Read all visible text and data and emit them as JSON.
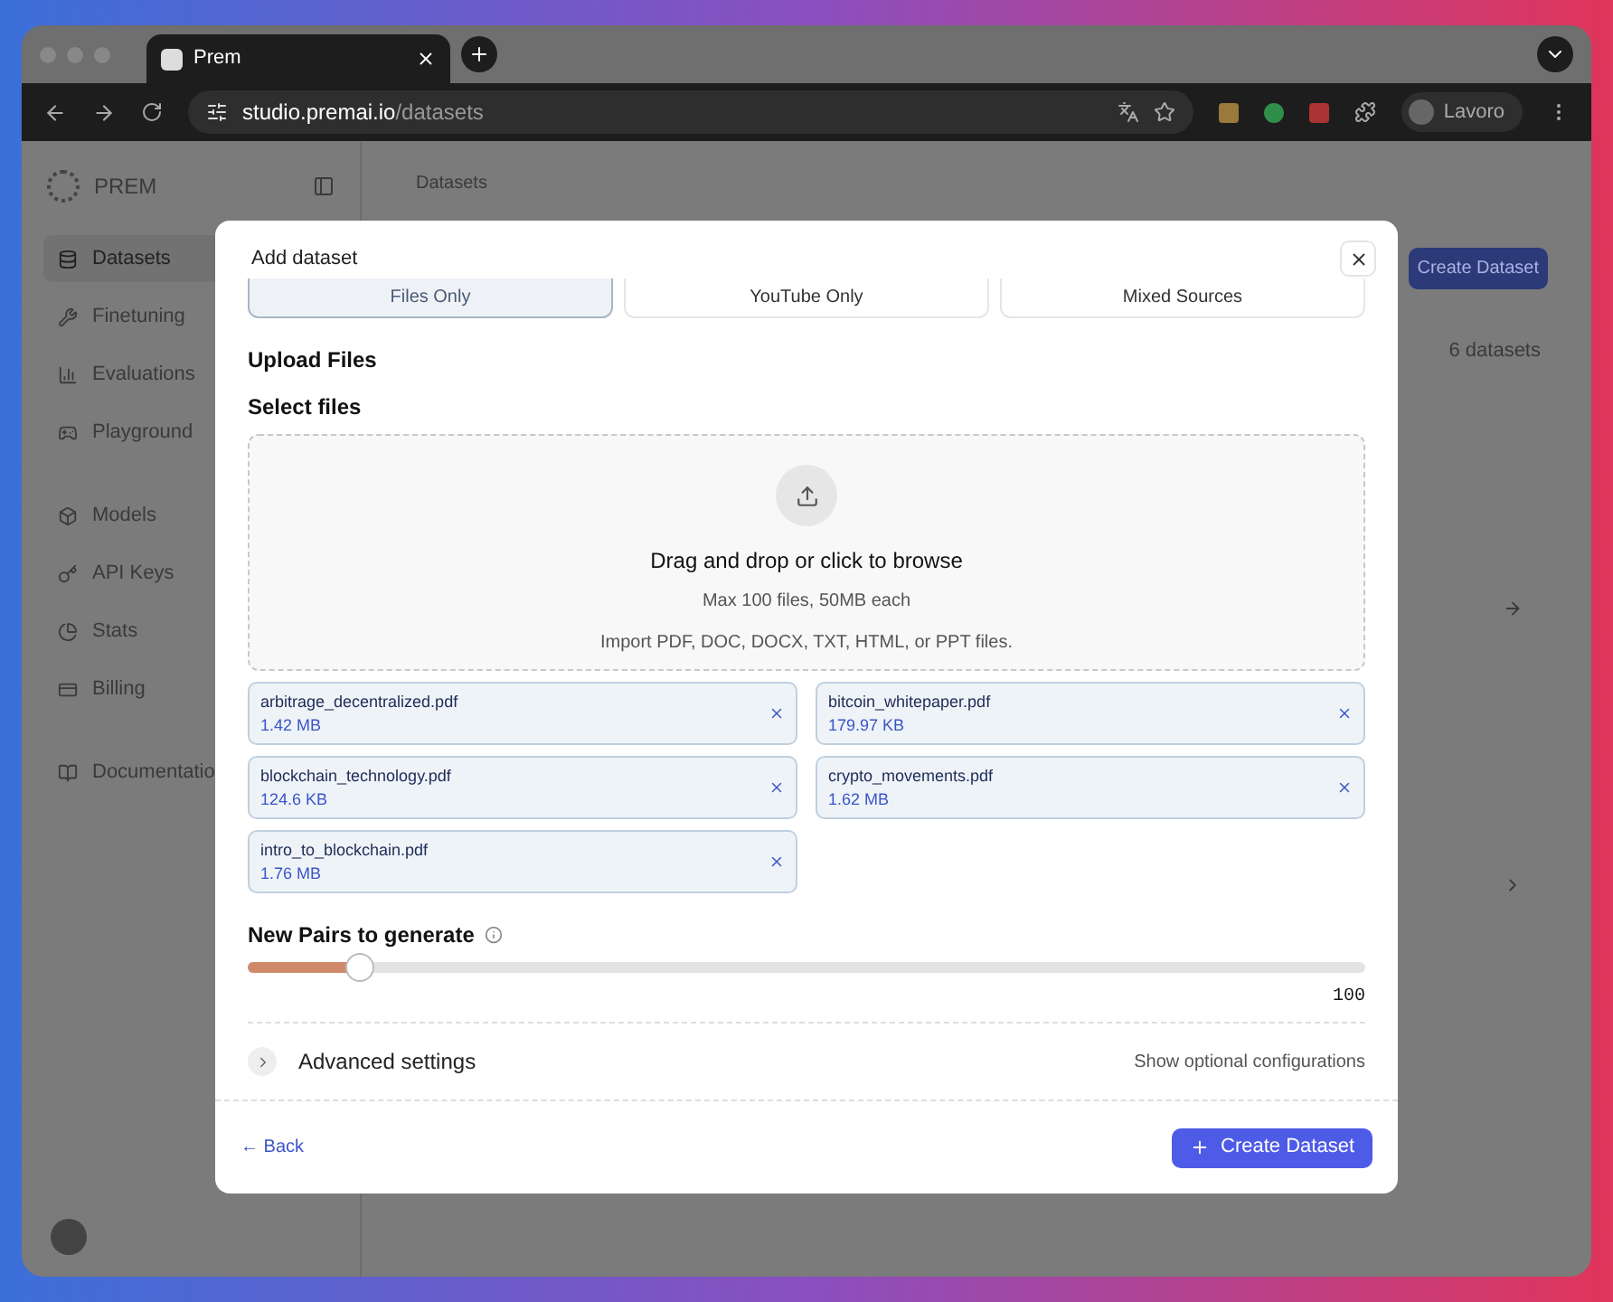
{
  "browser": {
    "tab_title": "Prem",
    "url_host": "studio.premai.io",
    "url_path": "/datasets",
    "profile": "Lavoro"
  },
  "sidebar": {
    "brand": "PREM",
    "items": [
      {
        "label": "Datasets",
        "selected": true
      },
      {
        "label": "Finetuning",
        "selected": false
      },
      {
        "label": "Evaluations",
        "selected": false
      },
      {
        "label": "Playground",
        "selected": false
      },
      {
        "label": "Models",
        "selected": false
      },
      {
        "label": "API Keys",
        "selected": false
      },
      {
        "label": "Stats",
        "selected": false
      },
      {
        "label": "Billing",
        "selected": false
      },
      {
        "label": "Documentatio",
        "selected": false
      }
    ]
  },
  "page": {
    "breadcrumb": "Datasets",
    "create_button": "Create Dataset",
    "count": "6 datasets"
  },
  "modal": {
    "title": "Add dataset",
    "tabs": [
      {
        "label": "Files Only",
        "selected": true
      },
      {
        "label": "YouTube Only",
        "selected": false
      },
      {
        "label": "Mixed Sources",
        "selected": false
      }
    ],
    "section_title": "Upload Files",
    "field_label": "Select files",
    "dropzone": {
      "title": "Drag and drop or click to browse",
      "limit": "Max 100 files, 50MB each",
      "formats": "Import PDF, DOC, DOCX, TXT, HTML, or PPT files."
    },
    "files": [
      {
        "name": "arbitrage_decentralized.pdf",
        "size": "1.42 MB"
      },
      {
        "name": "bitcoin_whitepaper.pdf",
        "size": "179.97 KB"
      },
      {
        "name": "blockchain_technology.pdf",
        "size": "124.6 KB"
      },
      {
        "name": "crypto_movements.pdf",
        "size": "1.62 MB"
      },
      {
        "name": "intro_to_blockchain.pdf",
        "size": "1.76 MB"
      }
    ],
    "pairs": {
      "label": "New Pairs to generate",
      "level": 0.1,
      "reading": "100"
    },
    "advanced": {
      "label": "Advanced settings",
      "hint": "Show optional configurations",
      "expanded": false
    },
    "back": "← Back",
    "submit": "Create Dataset"
  }
}
